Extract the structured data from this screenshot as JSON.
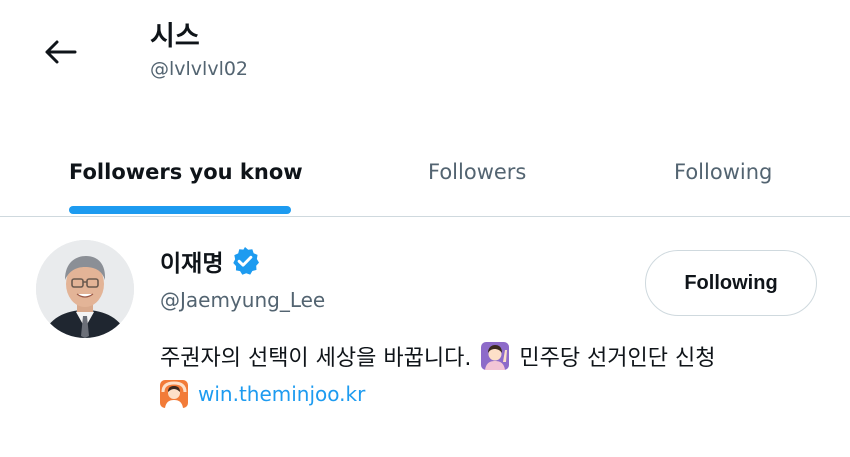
{
  "header": {
    "title": "시스",
    "handle": "@lvlvlvl02"
  },
  "tabs": [
    {
      "label": "Followers you know",
      "active": true
    },
    {
      "label": "Followers",
      "active": false
    },
    {
      "label": "Following",
      "active": false
    }
  ],
  "user": {
    "name": "이재명",
    "handle": "@Jaemyung_Lee",
    "verified": true,
    "follow_button_label": "Following",
    "bio_text_1": "주권자의 선택이 세상을 바꿉니다.",
    "bio_text_2": "민주당 선거인단 신청",
    "bio_emoji_1": "woman-raising-hand-icon",
    "link_emoji": "person-gesturing-ok-icon",
    "link_text": "win.theminjoo.kr"
  },
  "colors": {
    "accent": "#1d9bf0",
    "text_primary": "#0f1419",
    "text_secondary": "#536471",
    "border": "#cfd9de"
  }
}
